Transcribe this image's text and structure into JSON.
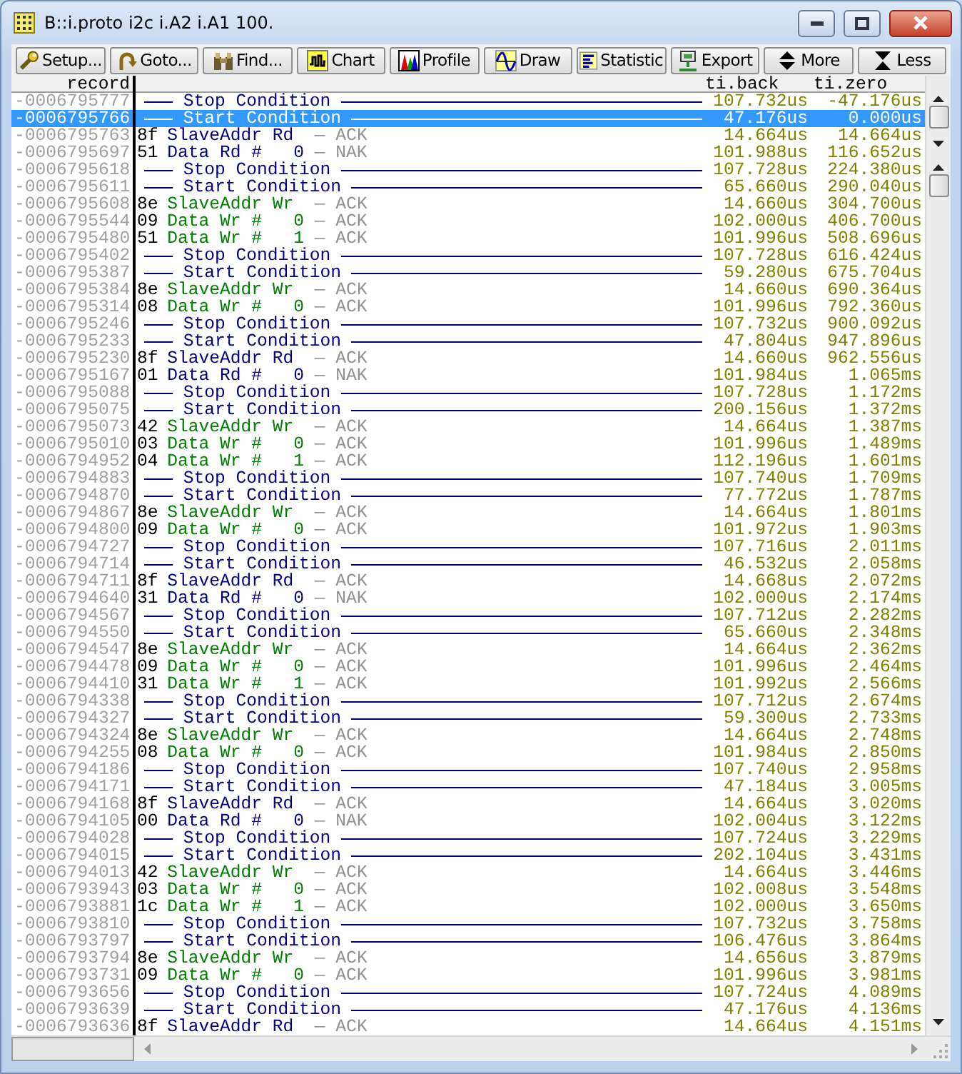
{
  "window": {
    "title": "B::i.proto i2c i.A2 i.A1 100."
  },
  "toolbar": [
    {
      "label": "Setup..."
    },
    {
      "label": "Goto..."
    },
    {
      "label": "Find..."
    },
    {
      "label": "Chart"
    },
    {
      "label": "Profile"
    },
    {
      "label": "Draw"
    },
    {
      "label": "Statistic"
    },
    {
      "label": "Export"
    },
    {
      "label": "More"
    },
    {
      "label": "Less"
    }
  ],
  "columns": {
    "record": "record",
    "back": "ti.back",
    "zero": "ti.zero"
  },
  "rows": [
    {
      "record": "-0006795777",
      "kind": "condition",
      "text": "Stop Condition",
      "back": "107.732us",
      "zero": "-47.176us",
      "selected": false
    },
    {
      "record": "-0006795766",
      "kind": "condition",
      "text": "Start Condition",
      "back": "47.176us",
      "zero": "0.000us",
      "selected": true
    },
    {
      "record": "-0006795763",
      "kind": "address",
      "byte": "8f",
      "read": true,
      "text": "SlaveAddr Rd",
      "ack": "— ACK",
      "back": "14.664us",
      "zero": "14.664us",
      "selected": false
    },
    {
      "record": "-0006795697",
      "kind": "data",
      "byte": "51",
      "read": true,
      "text": "Data Rd #",
      "index": "0",
      "ack": "— NAK",
      "back": "101.988us",
      "zero": "116.652us",
      "selected": false
    },
    {
      "record": "-0006795618",
      "kind": "condition",
      "text": "Stop Condition",
      "back": "107.728us",
      "zero": "224.380us",
      "selected": false
    },
    {
      "record": "-0006795611",
      "kind": "condition",
      "text": "Start Condition",
      "back": "65.660us",
      "zero": "290.040us",
      "selected": false
    },
    {
      "record": "-0006795608",
      "kind": "address",
      "byte": "8e",
      "read": false,
      "text": "SlaveAddr Wr",
      "ack": "— ACK",
      "back": "14.660us",
      "zero": "304.700us",
      "selected": false
    },
    {
      "record": "-0006795544",
      "kind": "data",
      "byte": "09",
      "read": false,
      "text": "Data Wr #",
      "index": "0",
      "ack": "— ACK",
      "back": "102.000us",
      "zero": "406.700us",
      "selected": false
    },
    {
      "record": "-0006795480",
      "kind": "data",
      "byte": "51",
      "read": false,
      "text": "Data Wr #",
      "index": "1",
      "ack": "— ACK",
      "back": "101.996us",
      "zero": "508.696us",
      "selected": false
    },
    {
      "record": "-0006795402",
      "kind": "condition",
      "text": "Stop Condition",
      "back": "107.728us",
      "zero": "616.424us",
      "selected": false
    },
    {
      "record": "-0006795387",
      "kind": "condition",
      "text": "Start Condition",
      "back": "59.280us",
      "zero": "675.704us",
      "selected": false
    },
    {
      "record": "-0006795384",
      "kind": "address",
      "byte": "8e",
      "read": false,
      "text": "SlaveAddr Wr",
      "ack": "— ACK",
      "back": "14.660us",
      "zero": "690.364us",
      "selected": false
    },
    {
      "record": "-0006795314",
      "kind": "data",
      "byte": "08",
      "read": false,
      "text": "Data Wr #",
      "index": "0",
      "ack": "— ACK",
      "back": "101.996us",
      "zero": "792.360us",
      "selected": false
    },
    {
      "record": "-0006795246",
      "kind": "condition",
      "text": "Stop Condition",
      "back": "107.732us",
      "zero": "900.092us",
      "selected": false
    },
    {
      "record": "-0006795233",
      "kind": "condition",
      "text": "Start Condition",
      "back": "47.804us",
      "zero": "947.896us",
      "selected": false
    },
    {
      "record": "-0006795230",
      "kind": "address",
      "byte": "8f",
      "read": true,
      "text": "SlaveAddr Rd",
      "ack": "— ACK",
      "back": "14.660us",
      "zero": "962.556us",
      "selected": false
    },
    {
      "record": "-0006795167",
      "kind": "data",
      "byte": "01",
      "read": true,
      "text": "Data Rd #",
      "index": "0",
      "ack": "— NAK",
      "back": "101.984us",
      "zero": "1.065ms",
      "selected": false
    },
    {
      "record": "-0006795088",
      "kind": "condition",
      "text": "Stop Condition",
      "back": "107.728us",
      "zero": "1.172ms",
      "selected": false
    },
    {
      "record": "-0006795075",
      "kind": "condition",
      "text": "Start Condition",
      "back": "200.156us",
      "zero": "1.372ms",
      "selected": false
    },
    {
      "record": "-0006795073",
      "kind": "address",
      "byte": "42",
      "read": false,
      "text": "SlaveAddr Wr",
      "ack": "— ACK",
      "back": "14.664us",
      "zero": "1.387ms",
      "selected": false
    },
    {
      "record": "-0006795010",
      "kind": "data",
      "byte": "03",
      "read": false,
      "text": "Data Wr #",
      "index": "0",
      "ack": "— ACK",
      "back": "101.996us",
      "zero": "1.489ms",
      "selected": false
    },
    {
      "record": "-0006794952",
      "kind": "data",
      "byte": "04",
      "read": false,
      "text": "Data Wr #",
      "index": "1",
      "ack": "— ACK",
      "back": "112.196us",
      "zero": "1.601ms",
      "selected": false
    },
    {
      "record": "-0006794883",
      "kind": "condition",
      "text": "Stop Condition",
      "back": "107.740us",
      "zero": "1.709ms",
      "selected": false
    },
    {
      "record": "-0006794870",
      "kind": "condition",
      "text": "Start Condition",
      "back": "77.772us",
      "zero": "1.787ms",
      "selected": false
    },
    {
      "record": "-0006794867",
      "kind": "address",
      "byte": "8e",
      "read": false,
      "text": "SlaveAddr Wr",
      "ack": "— ACK",
      "back": "14.664us",
      "zero": "1.801ms",
      "selected": false
    },
    {
      "record": "-0006794800",
      "kind": "data",
      "byte": "09",
      "read": false,
      "text": "Data Wr #",
      "index": "0",
      "ack": "— ACK",
      "back": "101.972us",
      "zero": "1.903ms",
      "selected": false
    },
    {
      "record": "-0006794727",
      "kind": "condition",
      "text": "Stop Condition",
      "back": "107.716us",
      "zero": "2.011ms",
      "selected": false
    },
    {
      "record": "-0006794714",
      "kind": "condition",
      "text": "Start Condition",
      "back": "46.532us",
      "zero": "2.058ms",
      "selected": false
    },
    {
      "record": "-0006794711",
      "kind": "address",
      "byte": "8f",
      "read": true,
      "text": "SlaveAddr Rd",
      "ack": "— ACK",
      "back": "14.668us",
      "zero": "2.072ms",
      "selected": false
    },
    {
      "record": "-0006794640",
      "kind": "data",
      "byte": "31",
      "read": true,
      "text": "Data Rd #",
      "index": "0",
      "ack": "— NAK",
      "back": "102.000us",
      "zero": "2.174ms",
      "selected": false
    },
    {
      "record": "-0006794567",
      "kind": "condition",
      "text": "Stop Condition",
      "back": "107.712us",
      "zero": "2.282ms",
      "selected": false
    },
    {
      "record": "-0006794550",
      "kind": "condition",
      "text": "Start Condition",
      "back": "65.660us",
      "zero": "2.348ms",
      "selected": false
    },
    {
      "record": "-0006794547",
      "kind": "address",
      "byte": "8e",
      "read": false,
      "text": "SlaveAddr Wr",
      "ack": "— ACK",
      "back": "14.664us",
      "zero": "2.362ms",
      "selected": false
    },
    {
      "record": "-0006794478",
      "kind": "data",
      "byte": "09",
      "read": false,
      "text": "Data Wr #",
      "index": "0",
      "ack": "— ACK",
      "back": "101.996us",
      "zero": "2.464ms",
      "selected": false
    },
    {
      "record": "-0006794410",
      "kind": "data",
      "byte": "31",
      "read": false,
      "text": "Data Wr #",
      "index": "1",
      "ack": "— ACK",
      "back": "101.992us",
      "zero": "2.566ms",
      "selected": false
    },
    {
      "record": "-0006794338",
      "kind": "condition",
      "text": "Stop Condition",
      "back": "107.712us",
      "zero": "2.674ms",
      "selected": false
    },
    {
      "record": "-0006794327",
      "kind": "condition",
      "text": "Start Condition",
      "back": "59.300us",
      "zero": "2.733ms",
      "selected": false
    },
    {
      "record": "-0006794324",
      "kind": "address",
      "byte": "8e",
      "read": false,
      "text": "SlaveAddr Wr",
      "ack": "— ACK",
      "back": "14.664us",
      "zero": "2.748ms",
      "selected": false
    },
    {
      "record": "-0006794255",
      "kind": "data",
      "byte": "08",
      "read": false,
      "text": "Data Wr #",
      "index": "0",
      "ack": "— ACK",
      "back": "101.984us",
      "zero": "2.850ms",
      "selected": false
    },
    {
      "record": "-0006794186",
      "kind": "condition",
      "text": "Stop Condition",
      "back": "107.740us",
      "zero": "2.958ms",
      "selected": false
    },
    {
      "record": "-0006794171",
      "kind": "condition",
      "text": "Start Condition",
      "back": "47.184us",
      "zero": "3.005ms",
      "selected": false
    },
    {
      "record": "-0006794168",
      "kind": "address",
      "byte": "8f",
      "read": true,
      "text": "SlaveAddr Rd",
      "ack": "— ACK",
      "back": "14.664us",
      "zero": "3.020ms",
      "selected": false
    },
    {
      "record": "-0006794105",
      "kind": "data",
      "byte": "00",
      "read": true,
      "text": "Data Rd #",
      "index": "0",
      "ack": "— NAK",
      "back": "102.004us",
      "zero": "3.122ms",
      "selected": false
    },
    {
      "record": "-0006794028",
      "kind": "condition",
      "text": "Stop Condition",
      "back": "107.724us",
      "zero": "3.229ms",
      "selected": false
    },
    {
      "record": "-0006794015",
      "kind": "condition",
      "text": "Start Condition",
      "back": "202.104us",
      "zero": "3.431ms",
      "selected": false
    },
    {
      "record": "-0006794013",
      "kind": "address",
      "byte": "42",
      "read": false,
      "text": "SlaveAddr Wr",
      "ack": "— ACK",
      "back": "14.664us",
      "zero": "3.446ms",
      "selected": false
    },
    {
      "record": "-0006793943",
      "kind": "data",
      "byte": "03",
      "read": false,
      "text": "Data Wr #",
      "index": "0",
      "ack": "— ACK",
      "back": "102.008us",
      "zero": "3.548ms",
      "selected": false
    },
    {
      "record": "-0006793881",
      "kind": "data",
      "byte": "1c",
      "read": false,
      "text": "Data Wr #",
      "index": "1",
      "ack": "— ACK",
      "back": "102.000us",
      "zero": "3.650ms",
      "selected": false
    },
    {
      "record": "-0006793810",
      "kind": "condition",
      "text": "Stop Condition",
      "back": "107.732us",
      "zero": "3.758ms",
      "selected": false
    },
    {
      "record": "-0006793797",
      "kind": "condition",
      "text": "Start Condition",
      "back": "106.476us",
      "zero": "3.864ms",
      "selected": false
    },
    {
      "record": "-0006793794",
      "kind": "address",
      "byte": "8e",
      "read": false,
      "text": "SlaveAddr Wr",
      "ack": "— ACK",
      "back": "14.656us",
      "zero": "3.879ms",
      "selected": false
    },
    {
      "record": "-0006793731",
      "kind": "data",
      "byte": "09",
      "read": false,
      "text": "Data Wr #",
      "index": "0",
      "ack": "— ACK",
      "back": "101.996us",
      "zero": "3.981ms",
      "selected": false
    },
    {
      "record": "-0006793656",
      "kind": "condition",
      "text": "Stop Condition",
      "back": "107.724us",
      "zero": "4.089ms",
      "selected": false
    },
    {
      "record": "-0006793639",
      "kind": "condition",
      "text": "Start Condition",
      "back": "47.176us",
      "zero": "4.136ms",
      "selected": false
    },
    {
      "record": "-0006793636",
      "kind": "address",
      "byte": "8f",
      "read": true,
      "text": "SlaveAddr Rd",
      "ack": "— ACK",
      "back": "14.664us",
      "zero": "4.151ms",
      "selected": false
    }
  ]
}
